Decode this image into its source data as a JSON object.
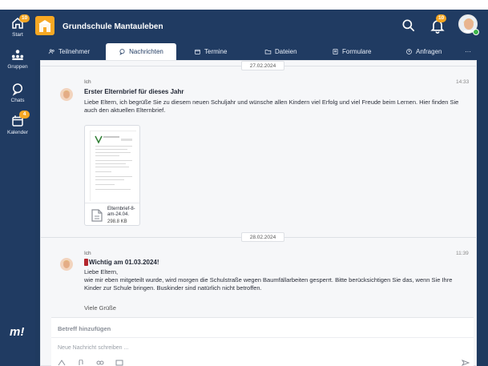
{
  "sidebar": {
    "items": [
      {
        "label": "Start",
        "icon": "home-icon",
        "badge": "10"
      },
      {
        "label": "Gruppen",
        "icon": "groups-icon"
      },
      {
        "label": "Chats",
        "icon": "chat-icon"
      },
      {
        "label": "Kalender",
        "icon": "calendar-icon",
        "badge": "4"
      }
    ],
    "brand": "m!"
  },
  "header": {
    "group_title": "Grundschule Mantauleben",
    "notifications_badge": "10",
    "icons": [
      "search-icon",
      "bell-icon",
      "avatar"
    ]
  },
  "tabs": [
    {
      "label": "Teilnehmer",
      "icon": "people-icon"
    },
    {
      "label": "Nachrichten",
      "icon": "chat-icon",
      "active": true
    },
    {
      "label": "Termine",
      "icon": "calendar-icon"
    },
    {
      "label": "Dateien",
      "icon": "folder-icon"
    },
    {
      "label": "Formulare",
      "icon": "form-icon"
    },
    {
      "label": "Anfragen",
      "icon": "question-icon"
    },
    {
      "label": "···",
      "icon": "more-icon"
    }
  ],
  "messages": [
    {
      "date": "27.02.2024",
      "author": "Ich",
      "time": "14:33",
      "title": "Erster Elternbrief für dieses Jahr",
      "body": "Liebe Eltern, ich begrüße Sie zu diesem neuen Schuljahr und wünsche allen Kindern viel Erfolg und viel Freude beim Lernen. Hier finden Sie auch den aktuellen Elternbrief.",
      "attachment": {
        "name": "Elternbrief-8-am-24.04.",
        "size": "298.8 KB"
      }
    },
    {
      "date": "28.02.2024",
      "author": "Ich",
      "time": "11:39",
      "title": "Wichtig am 01.03.2024!",
      "body_lines": [
        "Liebe Eltern,",
        "wie mir eben mitgeteilt wurde, wird morgen die Schulstraße wegen Baumfällarbeiten gesperrt. Bitte berücksichtigen Sie das, wenn Sie Ihre Kinder zur Schule bringen. Buskinder sind natürlich nicht betroffen.",
        "Viele Grüße"
      ]
    }
  ],
  "composer": {
    "subject_placeholder": "Betreff hinzufügen",
    "message_placeholder": "Neue Nachricht schreiben ..."
  },
  "colors": {
    "navy": "#203b62",
    "orange": "#f5a623",
    "badge": "#f5a623",
    "important": "#b3262d"
  }
}
